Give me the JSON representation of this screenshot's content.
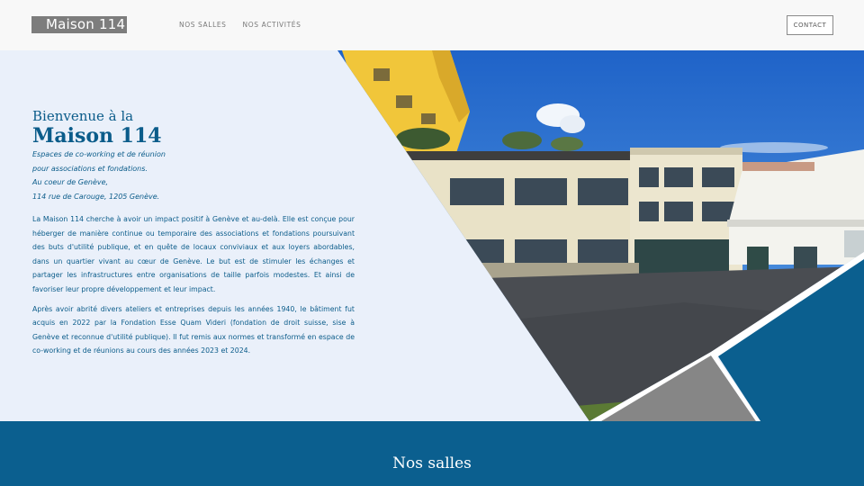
{
  "header": {
    "logo_text": "Maison 114",
    "nav": [
      "NOS SALLES",
      "NOS ACTIVITÉS"
    ],
    "contact_label": "CONTACT"
  },
  "hero": {
    "greeting": "Bienvenue à la",
    "name": "Maison 114",
    "tagline_lines": [
      "Espaces de co-working et de réunion",
      "pour associations et fondations.",
      "Au coeur de Genève,",
      "114 rue de Carouge, 1205 Genève."
    ],
    "paragraphs": [
      "La Maison 114 cherche à avoir un impact positif à Genève et au-delà. Elle est conçue pour héberger de manière continue ou temporaire des associations et fondations poursuivant des buts d'utilité publique, et en quête de locaux conviviaux et aux loyers abordables, dans un quartier vivant au cœur de Genève. Le but est de stimuler les échanges et partager les infrastructures entre organisations de taille parfois modestes. Et ainsi de favoriser leur propre développement et leur impact.",
      "Après avoir abrité divers ateliers et entreprises depuis les années 1940, le bâtiment fut acquis en 2022 par la Fondation Esse Quam Videri (fondation de droit suisse, sise à Genève et reconnue d'utilité publique). Il fut remis aux normes et transformé en espace de co-working et de réunions au cours des années 2023 et 2024."
    ]
  },
  "section": {
    "title": "Nos salles"
  },
  "colors": {
    "brand_blue": "#0b5f8f",
    "hero_bg": "#eaf0fa",
    "logo_bg": "#7d7d7d"
  }
}
